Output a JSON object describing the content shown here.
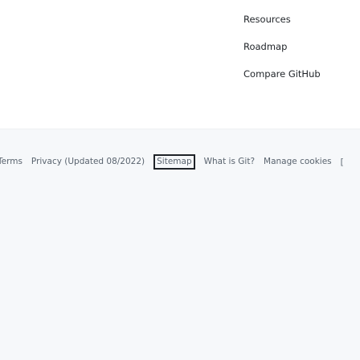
{
  "footer": {
    "links": [
      {
        "label": "Resources"
      },
      {
        "label": "Roadmap"
      },
      {
        "label": "Compare GitHub"
      }
    ]
  },
  "legal": {
    "terms": "Terms",
    "privacy": "Privacy (Updated 08/2022)",
    "sitemap": "Sitemap",
    "what_is_git": "What is Git?",
    "manage_cookies": "Manage cookies",
    "trailing": "["
  }
}
